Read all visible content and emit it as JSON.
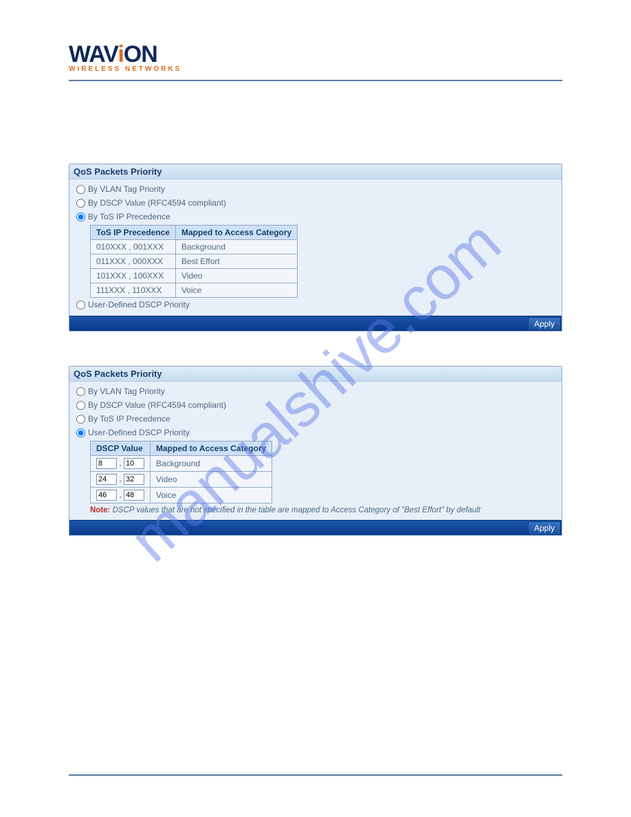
{
  "logo": {
    "brand_part1": "WAV",
    "brand_i": "i",
    "brand_part2": "ON",
    "subtitle": "WIRELESS NETWORKS"
  },
  "watermark": "manualshive.com",
  "panel1": {
    "title": "QoS Packets Priority",
    "opt_vlan": "By VLAN Tag Priority",
    "opt_dscp": "By DSCP Value (RFC4594 compliant)",
    "opt_tos": "By ToS IP Precedence",
    "opt_userdscp": "User-Defined DSCP Priority",
    "tos_table": {
      "headers": [
        "ToS IP Precedence",
        "Mapped to Access Category"
      ],
      "rows": [
        {
          "tos": "010XXX , 001XXX",
          "cat": "Background"
        },
        {
          "tos": "011XXX , 000XXX",
          "cat": "Best Effort"
        },
        {
          "tos": "101XXX , 100XXX",
          "cat": "Video"
        },
        {
          "tos": "111XXX , 110XXX",
          "cat": "Voice"
        }
      ]
    },
    "apply": "Apply"
  },
  "panel2": {
    "title": "QoS Packets Priority",
    "opt_vlan": "By VLAN Tag Priority",
    "opt_dscp": "By DSCP Value (RFC4594 compliant)",
    "opt_tos": "By ToS IP Precedence",
    "opt_userdscp": "User-Defined DSCP Priority",
    "dscp_table": {
      "headers": [
        "DSCP Value",
        "Mapped to Access Category"
      ],
      "rows": [
        {
          "a": "8",
          "b": "10",
          "cat": "Background"
        },
        {
          "a": "24",
          "b": "32",
          "cat": "Video"
        },
        {
          "a": "46",
          "b": "48",
          "cat": "Voice"
        }
      ]
    },
    "note_label": "Note:",
    "note_text": "DSCP values that are not specified in the table are mapped to Access Category of \"Best Effort\" by default",
    "apply": "Apply"
  }
}
